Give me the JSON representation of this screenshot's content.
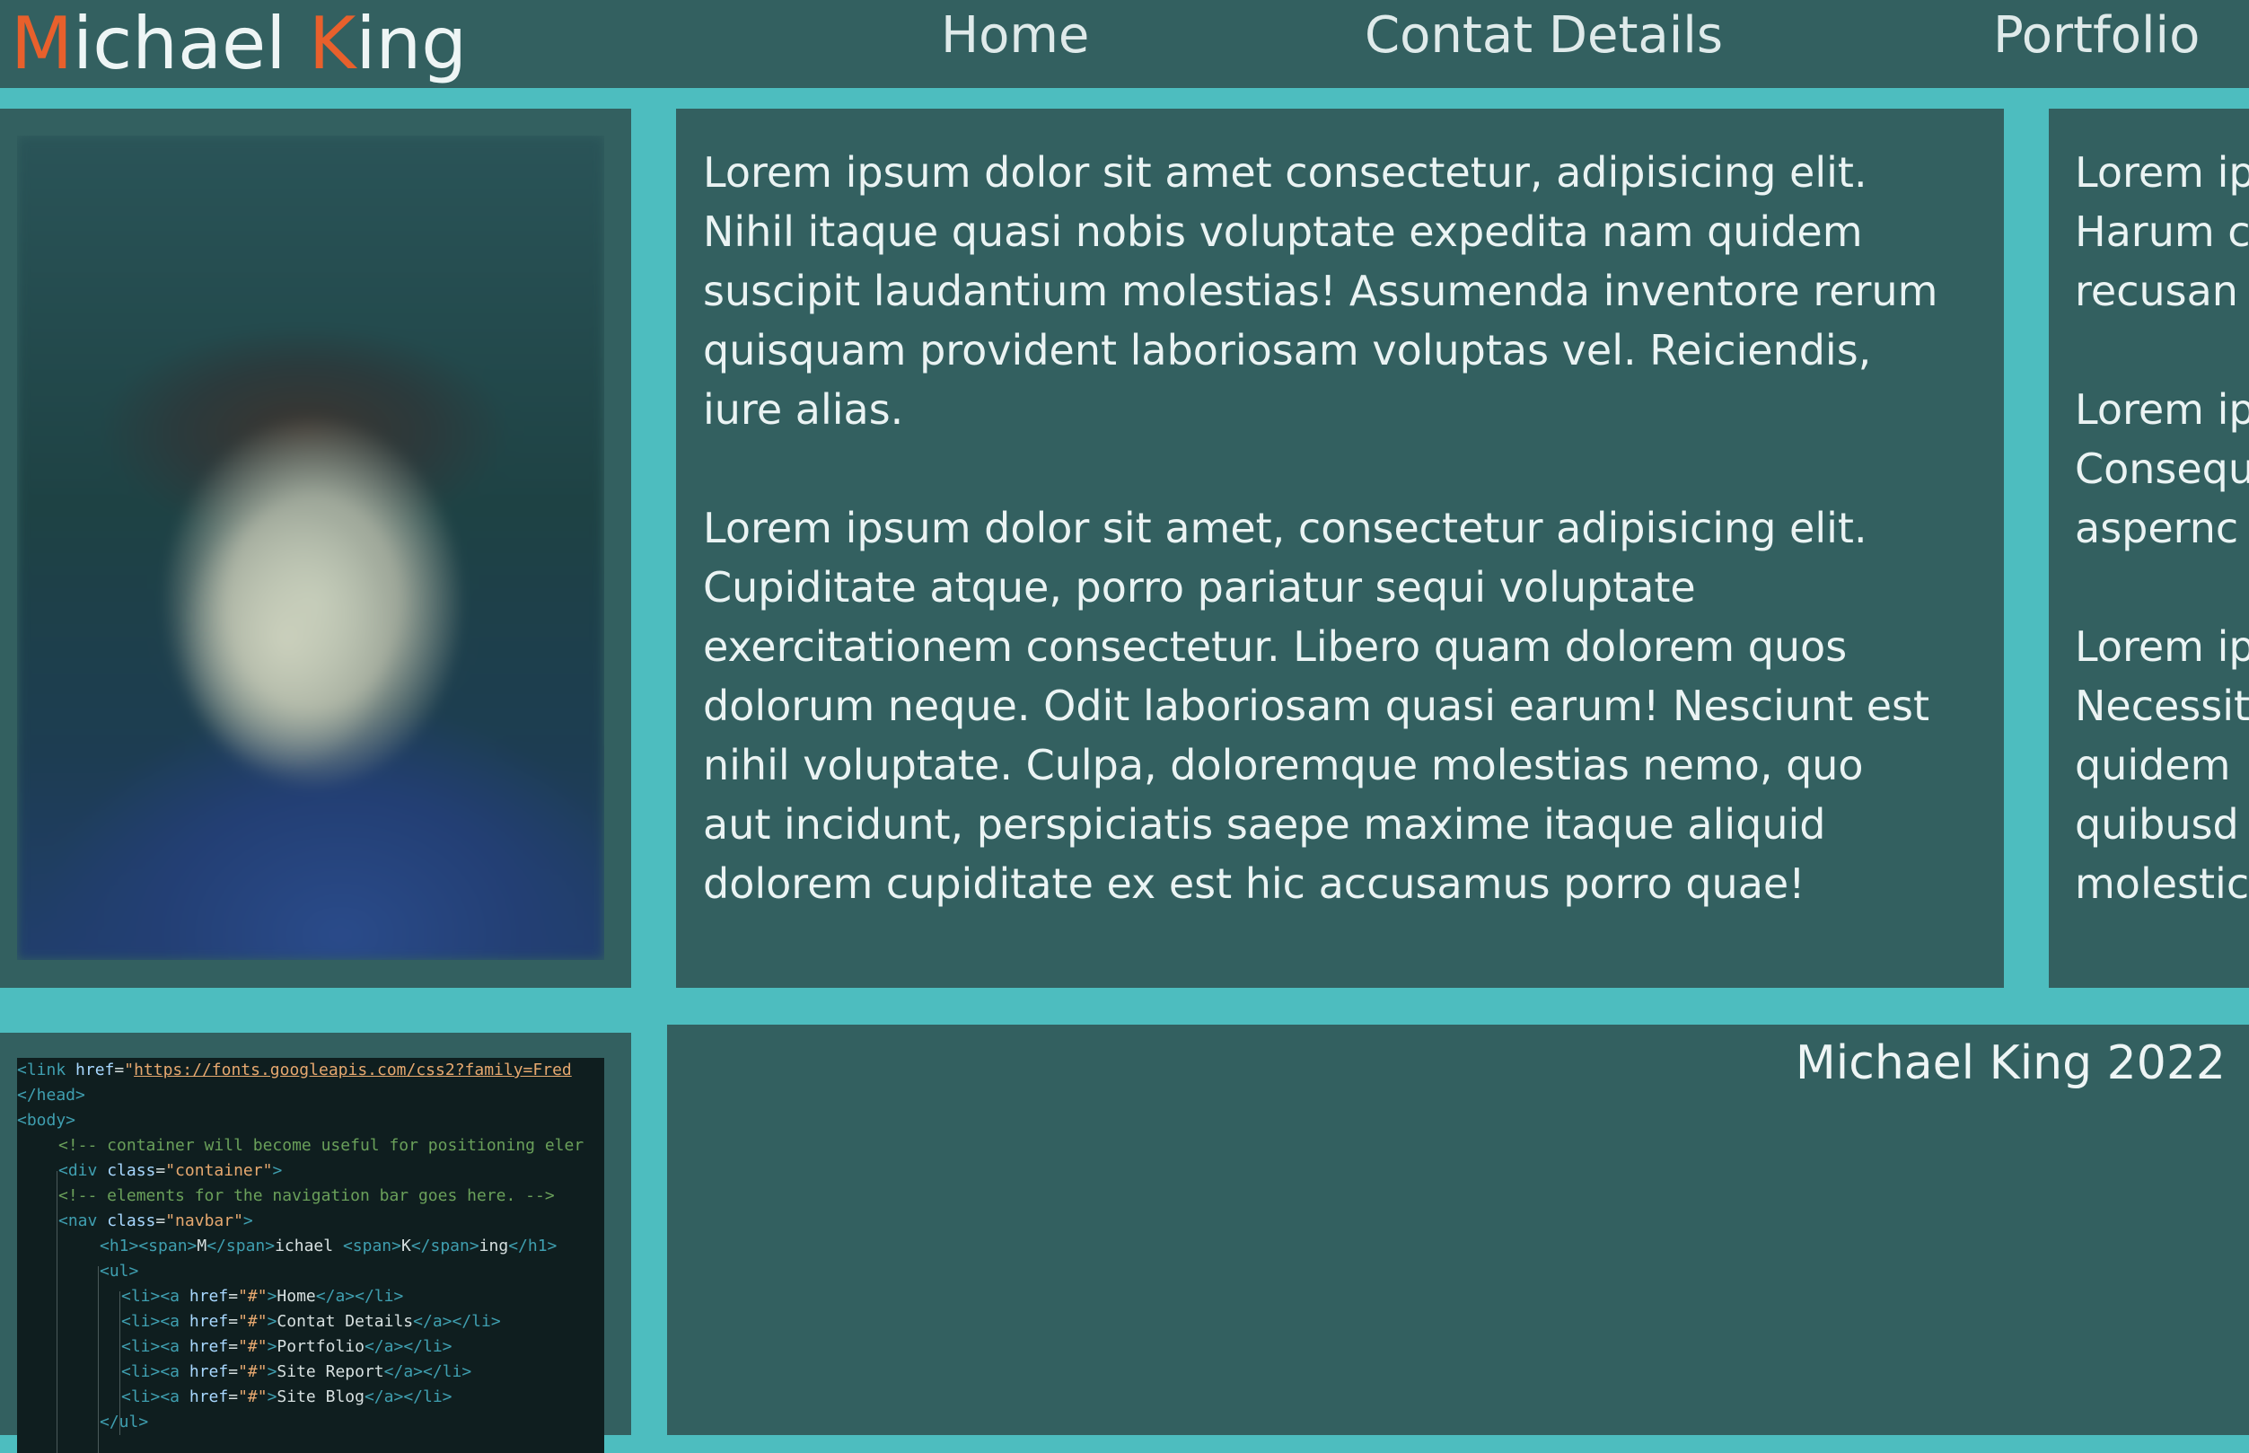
{
  "colors": {
    "page_bg": "#4dbdbf",
    "panel_bg": "#336060",
    "accent": "#e8602c",
    "text": "#eaf3f3"
  },
  "navbar": {
    "brand_initial_first": "M",
    "brand_rest_first": "ichael ",
    "brand_initial_last": "K",
    "brand_rest_last": "ing",
    "links": [
      "Home",
      "Contat Details",
      "Portfolio"
    ]
  },
  "main": {
    "column_1": {
      "paragraphs": [
        "Lorem ipsum dolor sit amet consectetur, adipisicing elit.\nNihil itaque quasi nobis voluptate expedita nam quidem\nsuscipit laudantium molestias! Assumenda inventore rerum\nquisquam provident laboriosam voluptas vel. Reiciendis,\niure alias.",
        "Lorem ipsum dolor sit amet, consectetur adipisicing elit.\nCupiditate atque, porro pariatur sequi voluptate\nexercitationem consectetur. Libero quam dolorem quos\ndolorum neque. Odit laboriosam quasi earum! Nesciunt est\nnihil voluptate. Culpa, doloremque molestias nemo, quo\naut incidunt, perspiciatis saepe maxime itaque aliquid\ndolorem cupiditate ex est hic accusamus porro quae!"
      ]
    },
    "column_2": {
      "paragraphs": [
        "Lorem ip\nHarum c\nrecusan",
        "Lorem ip\nConsequ\naspernc",
        "Lorem ip\nNecessit\nquidem\nquibusd\nmolestic"
      ]
    }
  },
  "code_screenshot": {
    "lines": [
      "<link href=\"https://fonts.googleapis.com/css2?family=Fred",
      "</head>",
      "<body>",
      "<!-- container will become useful for positioning eler",
      "<div class=\"container\">",
      "<!-- elements for the navigation bar goes here. -->",
      "<nav class=\"navbar\">",
      "<h1><span>M</span>ichael <span>K</span>ing</h1>",
      "<ul>",
      "<li><a href=\"#\">Home</a></li>",
      "<li><a href=\"#\">Contat Details</a></li>",
      "<li><a href=\"#\">Portfolio</a></li>",
      "<li><a href=\"#\">Site Report</a></li>",
      "<li><a href=\"#\">Site Blog</a></li>",
      "</ul>"
    ]
  },
  "footer": {
    "text": "Michael King 2022"
  }
}
